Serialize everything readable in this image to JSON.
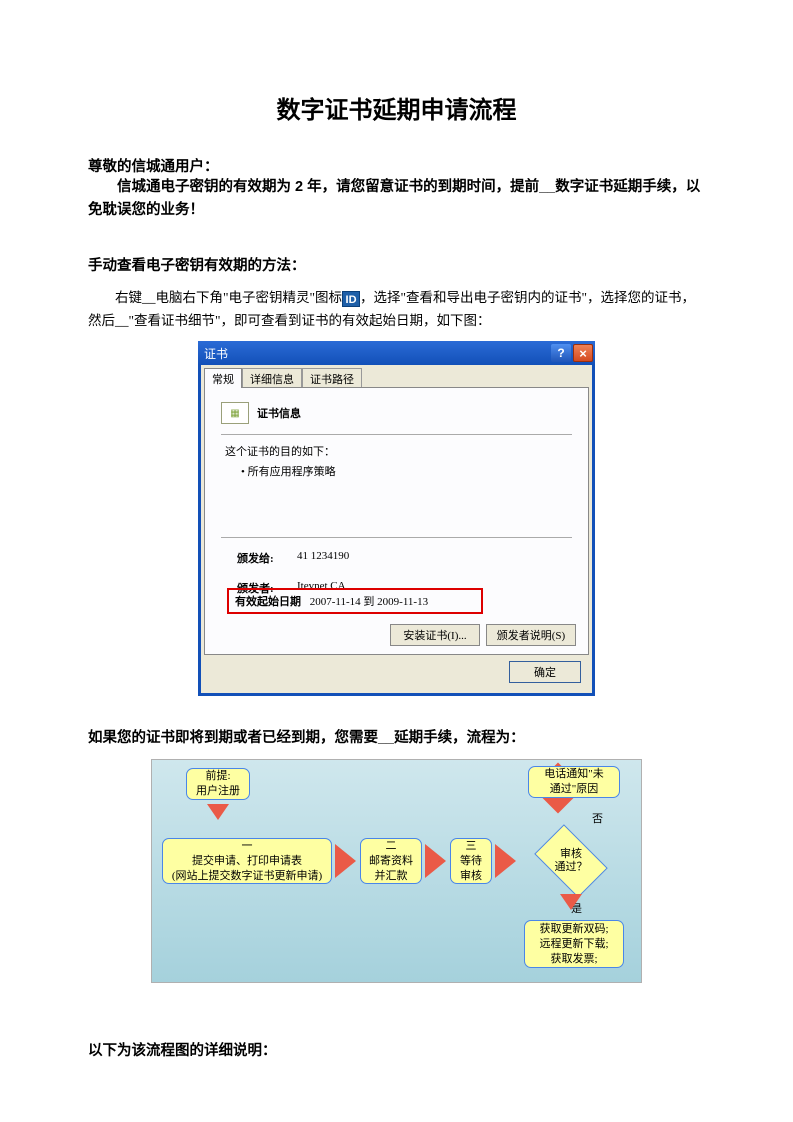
{
  "title": "数字证书延期申请流程",
  "intro": {
    "greeting": "尊敬的信城通用户：",
    "body": "信城通电子密钥的有效期为 2 年，请您留意证书的到期时间，提前__数字证书延期手续，以免耽误您的业务！"
  },
  "section1": {
    "heading": "手动查看电子密钥有效期的方法：",
    "para_a": "右键__电脑右下角\"电子密钥精灵\"图标",
    "icon": "ID",
    "para_b": "，选择\"查看和导出电子密钥内的证书\"，选择您的证书，然后__\"查看证书细节\"，即可查看到证书的有效起始日期，如下图："
  },
  "cert_dialog": {
    "title": "证书",
    "tabs": {
      "t1": "常规",
      "t2": "详细信息",
      "t3": "证书路径"
    },
    "info_heading": "证书信息",
    "purpose_heading": "这个证书的目的如下：",
    "purpose_item": "• 所有应用程序策略",
    "issued_to_label": "颁发给:",
    "issued_to": "41 1234190",
    "issued_by_label": "颁发者:",
    "issued_by": "Itevnet CA",
    "valid_label": "有效起始日期",
    "valid_value": "2007-11-14 到 2009-11-13",
    "btn_install": "安装证书(I)...",
    "btn_statement": "颁发者说明(S)",
    "btn_ok": "确定"
  },
  "section2": {
    "heading": "如果您的证书即将到期或者已经到期，您需要__延期手续，流程为："
  },
  "flow": {
    "pre": "前提:\n用户注册",
    "step1": "一\n提交申请、打印申请表\n(网站上提交数字证书更新申请)",
    "step2": "二\n邮寄资料\n并汇款",
    "step3": "三\n等待\n审核",
    "decision": "审核\n通过？",
    "no_label": "否",
    "yes_label": "是",
    "reject": "电话通知\"未\n通过\"原因",
    "approve": "获取更新双码;\n远程更新下载;\n获取发票;"
  },
  "footer": "以下为该流程图的详细说明："
}
